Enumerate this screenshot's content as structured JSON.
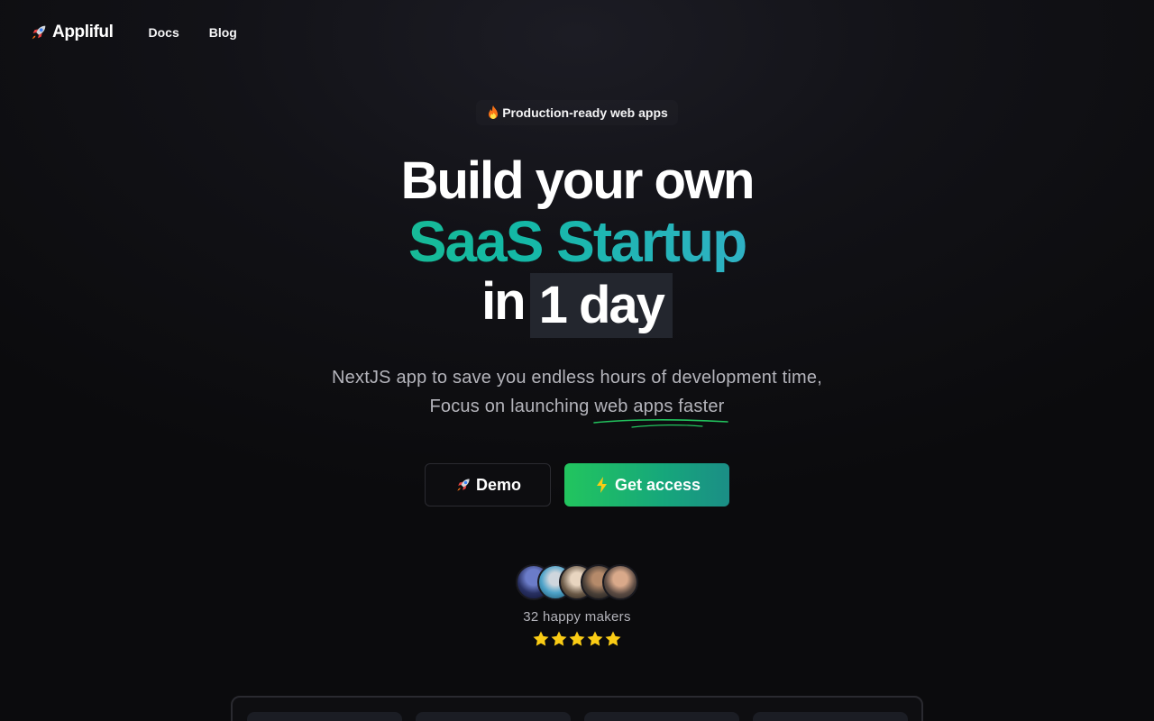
{
  "header": {
    "logo_text": "Appliful",
    "nav": [
      {
        "label": "Docs"
      },
      {
        "label": "Blog"
      }
    ]
  },
  "hero": {
    "badge": "Production-ready web apps",
    "headline_line1": "Build your own",
    "headline_line2": "SaaS Startup",
    "headline_line3_prefix": "in",
    "headline_line3_highlight": "1 day",
    "subtext_line1": "NextJS app to save you endless hours of development time,",
    "subtext_line2_prefix": "Focus on launching",
    "subtext_line2_underlined": "web apps faster",
    "demo_button": "Demo",
    "access_button": "Get access"
  },
  "social_proof": {
    "makers_text": "32 happy makers",
    "rating_stars": 5
  },
  "colors": {
    "accent_green": "#22c55e",
    "accent_blue": "#60a5fa",
    "background": "#0b0b0d",
    "star": "#facc15"
  },
  "icons": [
    "rocket-icon",
    "flame-icon",
    "lightning-icon",
    "star-icon",
    "squiggle-underline"
  ]
}
